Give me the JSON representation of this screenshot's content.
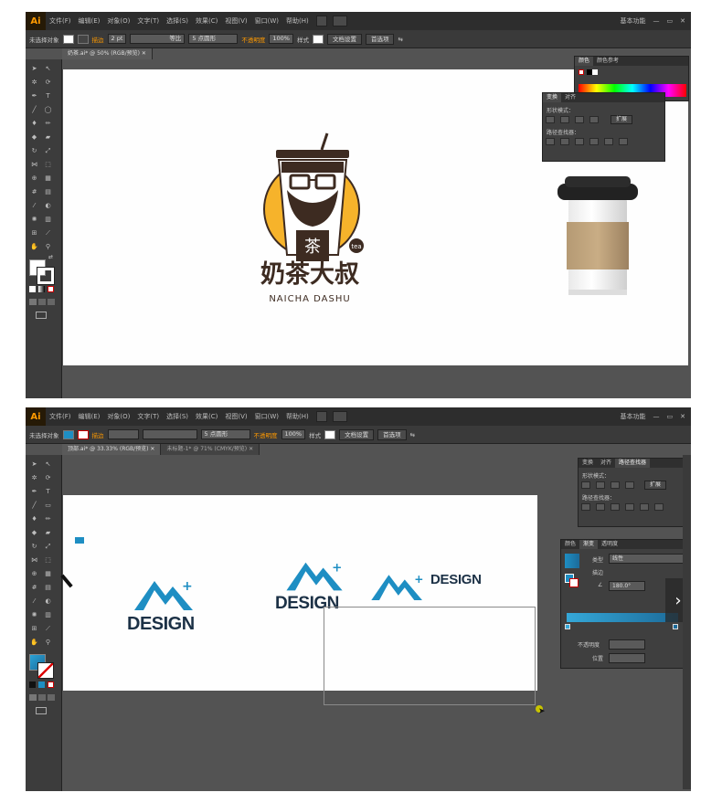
{
  "app_logo": "Ai",
  "top": {
    "menu": [
      "文件(F)",
      "编辑(E)",
      "对象(O)",
      "文字(T)",
      "选择(S)",
      "效果(C)",
      "视图(V)",
      "窗口(W)",
      "帮助(H)"
    ],
    "workspace": "基本功能",
    "ctrl": {
      "selection": "未选择对象",
      "stroke_label": "描边",
      "stroke_value": "2 pt",
      "profile": "等比",
      "brush": "5 点圆形",
      "opacity_label": "不透明度",
      "opacity_value": "100%",
      "style_label": "样式",
      "doc_setup": "文档设置",
      "prefs": "首选项"
    },
    "doc_tab": "奶茶.ai* @ 50% (RGB/预览)",
    "panels": {
      "color_tabs": [
        "颜色",
        "颜色参考"
      ],
      "pathfinder_tabs": [
        "变换",
        "对齐"
      ],
      "shape_modes": "形状模式：",
      "pathfinder": "路径查找器：",
      "expand": "扩展"
    },
    "logo": {
      "tag": "tea",
      "chinese": "奶茶大叔",
      "english": "NAICHA DASHU",
      "cup_glyph": "茶"
    }
  },
  "bottom": {
    "menu": [
      "文件(F)",
      "编辑(E)",
      "对象(O)",
      "文字(T)",
      "选择(S)",
      "效果(C)",
      "视图(V)",
      "窗口(W)",
      "帮助(H)"
    ],
    "workspace": "基本功能",
    "ctrl": {
      "selection": "未选择对象",
      "stroke_label": "描边",
      "brush": "5 点圆形",
      "opacity_label": "不透明度",
      "opacity_value": "100%",
      "style_label": "样式",
      "doc_setup": "文档设置",
      "prefs": "首选项"
    },
    "doc_tabs": [
      "顶部.ai* @ 33.33% (RGB/预览)",
      "未标题-1* @ 71% (CMYK/预览)"
    ],
    "panels": {
      "pathfinder_tabs": [
        "变换",
        "对齐",
        "路径查找器"
      ],
      "shape_modes": "形状模式：",
      "pathfinder": "路径查找器：",
      "expand": "扩展",
      "gradient_tabs": [
        "颜色",
        "渐变",
        "透明度"
      ],
      "type_label": "类型",
      "type_value": "线性",
      "stroke_label": "描边",
      "angle_value": "180.0°",
      "opacity_label": "不透明度",
      "position_label": "位置"
    },
    "logos": [
      "DESIGN",
      "DESIGN",
      "DESIGN"
    ]
  },
  "colors": {
    "accent_yellow": "#f6b32b",
    "dark_brown": "#3d2b21",
    "design_blue": "#1e8ec3",
    "design_navy": "#1c3146"
  }
}
